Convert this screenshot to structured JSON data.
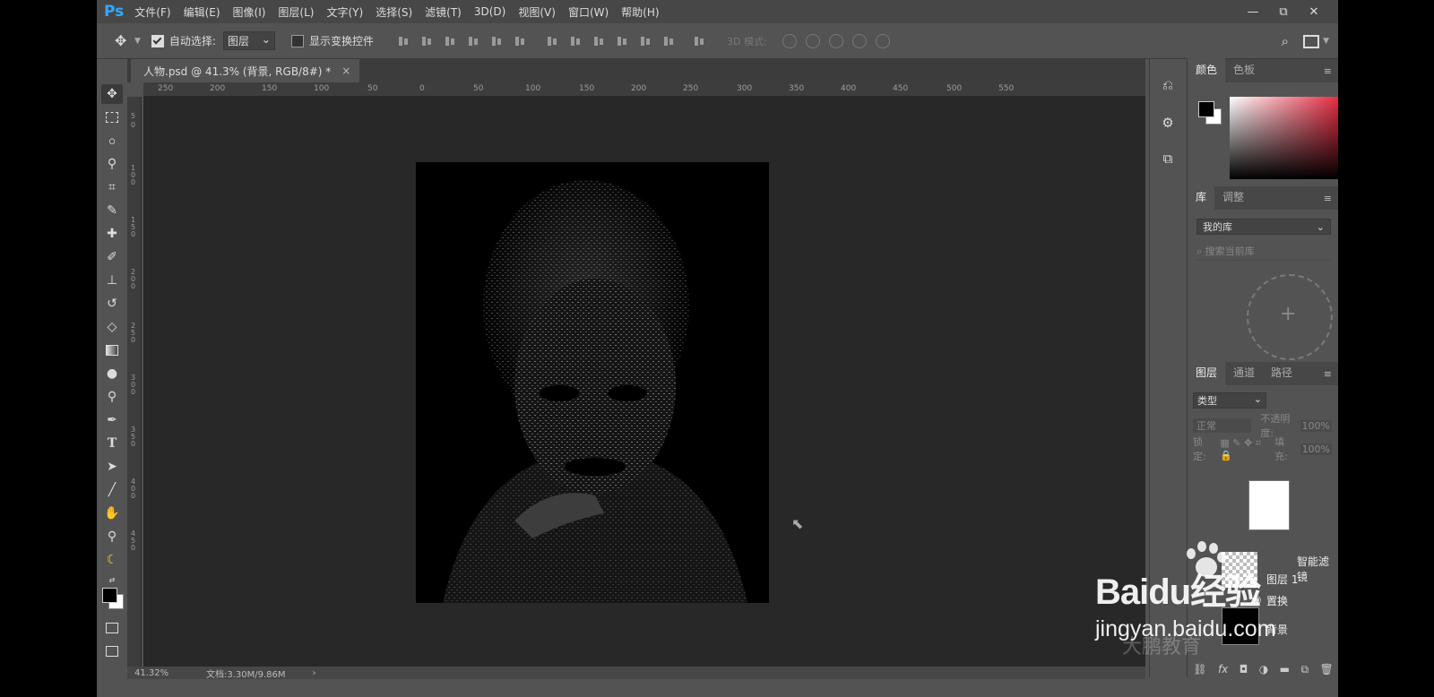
{
  "app": {
    "logo": "Ps",
    "menu": [
      "文件(F)",
      "编辑(E)",
      "图像(I)",
      "图层(L)",
      "文字(Y)",
      "选择(S)",
      "滤镜(T)",
      "3D(D)",
      "视图(V)",
      "窗口(W)",
      "帮助(H)"
    ],
    "window_controls": [
      "—",
      "⧉",
      "✕"
    ]
  },
  "options_bar": {
    "auto_select_label": "自动选择:",
    "auto_select_checked": true,
    "auto_select_target": "图层",
    "show_transform_label": "显示变换控件",
    "show_transform_checked": false,
    "mode3d_label": "3D 模式:"
  },
  "document": {
    "tab_title": "人物.psd @ 41.3% (背景, RGB/8#) *",
    "close": "×",
    "ruler_h": [
      "250",
      "200",
      "150",
      "100",
      "50",
      "0",
      "50",
      "100",
      "150",
      "200",
      "250",
      "300",
      "350",
      "400",
      "450",
      "500",
      "550"
    ],
    "ruler_v": [
      "5",
      "0",
      "1",
      "0",
      "0",
      "1",
      "5",
      "0",
      "2",
      "0",
      "0",
      "2",
      "5",
      "0",
      "3",
      "0",
      "0",
      "3",
      "5",
      "0",
      "4",
      "0",
      "0",
      "4",
      "5",
      "0"
    ]
  },
  "status": {
    "zoom": "41.32%",
    "doc_size": "文档:3.30M/9.86M",
    "arrow": "›"
  },
  "panels": {
    "color": {
      "tabs": [
        "颜色",
        "色板"
      ],
      "fg": "#000000",
      "bg": "#ffffff"
    },
    "library": {
      "tabs": [
        "库",
        "调整"
      ],
      "selected_library": "我的库",
      "search_placeholder": "搜索当前库"
    },
    "layers": {
      "tabs": [
        "图层",
        "通道",
        "路径"
      ],
      "filter_kind": "类型",
      "blend_mode": "正常",
      "opacity_label": "不透明度:",
      "opacity_value": "100%",
      "lock_label": "锁定:",
      "fill_label": "填充:",
      "fill_value": "100%",
      "items": [
        {
          "name": "智能滤镜"
        },
        {
          "name": "置换"
        },
        {
          "name": "图层 1"
        },
        {
          "name": "背景"
        }
      ]
    }
  },
  "watermark": {
    "brand": "Baidu经验",
    "url": "jingyan.baidu.com",
    "overlay": "大鹏教育"
  }
}
